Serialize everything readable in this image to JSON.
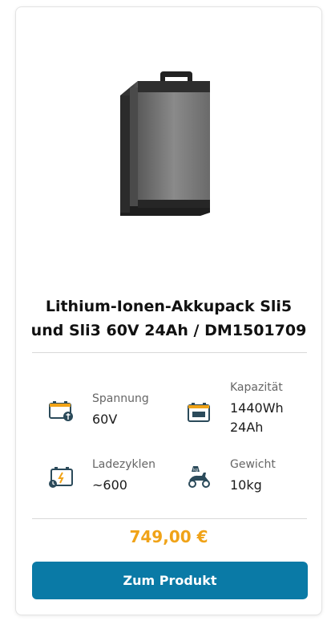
{
  "product": {
    "title_line1": "Lithium-Ionen-Akkupack Sli5",
    "title_line2": "und Sli3 60V 24Ah / DM1501709",
    "price": "749,00 €",
    "cta_label": "Zum Produkt"
  },
  "specs": {
    "spannung": {
      "label": "Spannung",
      "value": "60V",
      "icon": "battery-voltage-icon"
    },
    "kapazitaet": {
      "label": "Kapazität",
      "value": "1440Wh",
      "value2": "24Ah",
      "icon": "battery-capacity-icon"
    },
    "ladezyklen": {
      "label": "Ladezyklen",
      "value": "~600",
      "icon": "battery-cycles-icon"
    },
    "gewicht": {
      "label": "Gewicht",
      "value": "10kg",
      "icon": "scooter-weight-icon"
    }
  },
  "colors": {
    "price": "#f0a318",
    "button": "#0a7aa6",
    "icon_dark": "#2b4a5a",
    "icon_accent": "#f0a318"
  }
}
